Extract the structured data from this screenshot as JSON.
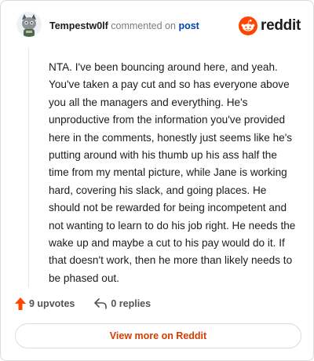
{
  "header": {
    "author": "Tempestw0lf",
    "action_text": "commented on",
    "post_link": "post",
    "brand_wordmark": "reddit",
    "avatar_icon": "cat-avatar",
    "brand_icon": "reddit-snoo-icon"
  },
  "comment": {
    "body": "NTA. I've been bouncing around here, and yeah. You've taken a pay cut and so has everyone above you all the managers and everything. He's unproductive from the information you've provided here in the comments, honestly just seems like he's putting around with his thumb up his ass half the time from my mental picture, while Jane is working hard, covering his slack, and going places. He should not be rewarded for being incompetent and not wanting to learn to do his job right. He needs the wake up and maybe a cut to his pay would do it. If that doesn't work, then he more than likely needs to be phased out."
  },
  "footer": {
    "upvotes_label": "9 upvotes",
    "replies_label": "0 replies",
    "upvote_icon": "upvote-arrow-icon",
    "reply_icon": "reply-arrow-icon"
  },
  "view_more": {
    "label": "View more on Reddit"
  },
  "colors": {
    "brand_orange": "#ff4500",
    "link_blue": "#0045ac",
    "view_more_text": "#d93a00"
  }
}
